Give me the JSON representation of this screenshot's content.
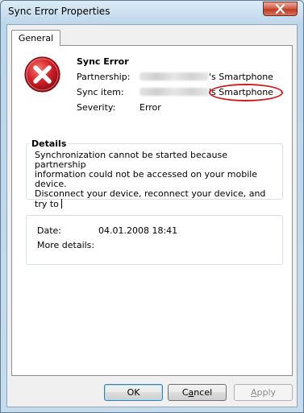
{
  "window": {
    "title": "Sync Error Properties"
  },
  "tabs": [
    {
      "label": "General"
    }
  ],
  "error": {
    "heading": "Sync Error",
    "partnership_label": "Partnership:",
    "partnership_value": "'s Smartphone",
    "sync_item_label": "Sync item:",
    "sync_item_value": "'s Smartphone",
    "severity_label": "Severity:",
    "severity_value": "Error"
  },
  "details": {
    "title": "Details",
    "line1": "Synchronization cannot be started because partnership",
    "line2": "information could not be accessed on your mobile device.",
    "line3": "Disconnect your device, reconnect your device, and try to"
  },
  "info": {
    "date_label": "Date:",
    "date_value": "04.01.2008 18:41",
    "more_details_label": "More details:"
  },
  "buttons": {
    "ok": "OK",
    "cancel_prefix": "C",
    "cancel_accel": "a",
    "cancel_suffix": "ncel",
    "apply_accel": "A",
    "apply_suffix": "pply"
  },
  "colors": {
    "annotation_oval": "#d21a1a",
    "error_icon": "#c8102e",
    "close_button": "#c03a23"
  },
  "icons": {
    "window_close": "close-x-icon",
    "error": "error-circle-x-icon"
  }
}
